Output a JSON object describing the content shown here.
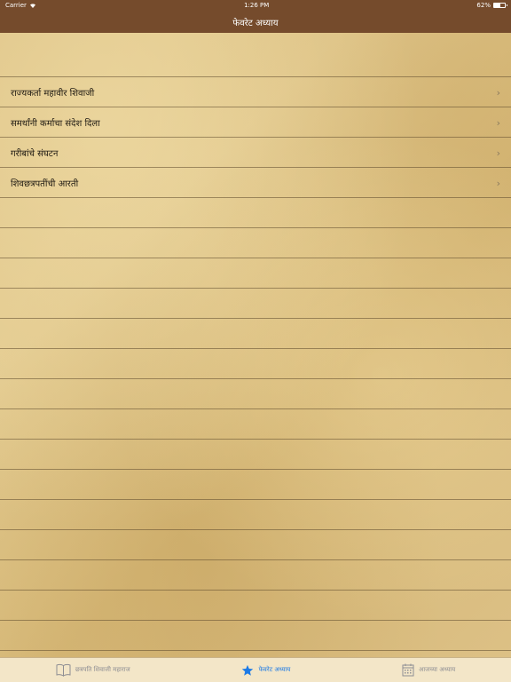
{
  "status": {
    "carrier": "Carrier",
    "time": "1:26 PM",
    "battery": "62%",
    "battery_level": 0.62
  },
  "header": {
    "title": "फेवरेट अध्याय"
  },
  "favorites": [
    {
      "label": "राज्यकर्ता महावीर शिवाजी"
    },
    {
      "label": "समर्थांनी कर्माचा संदेश दिला"
    },
    {
      "label": "गरीबांचे संघटन"
    },
    {
      "label": "शिवछत्रपतींची आरती"
    }
  ],
  "tabs": [
    {
      "label": "छत्रपति शिवाजी महाराज",
      "icon": "book-icon",
      "active": false
    },
    {
      "label": "फेवरेट अध्याय",
      "icon": "star-icon",
      "active": true
    },
    {
      "label": "आजच्या अध्याय",
      "icon": "calendar-icon",
      "active": false
    }
  ],
  "colors": {
    "nav_bar": "#754b2c",
    "active_tab": "#1c7ae6",
    "inactive_tab": "#8e8e93"
  }
}
